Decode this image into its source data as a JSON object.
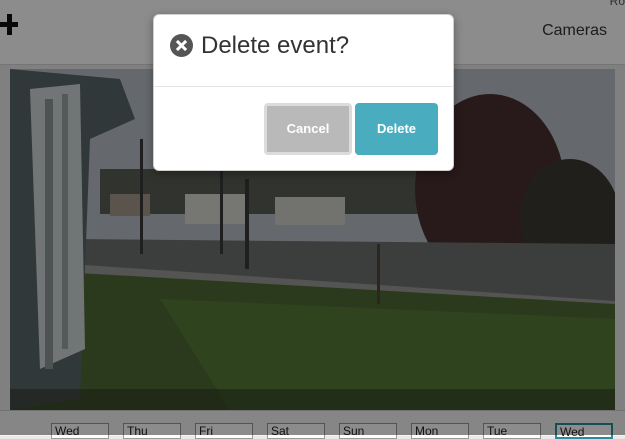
{
  "header": {
    "add_icon": "plus-icon",
    "nav_cameras": "Cameras",
    "corner_text": "Ro"
  },
  "timeline": {
    "days": [
      {
        "label": "Wed",
        "active": false
      },
      {
        "label": "Thu",
        "active": false
      },
      {
        "label": "Fri",
        "active": false
      },
      {
        "label": "Sat",
        "active": false
      },
      {
        "label": "Sun",
        "active": false
      },
      {
        "label": "Mon",
        "active": false
      },
      {
        "label": "Tue",
        "active": false
      },
      {
        "label": "Wed",
        "active": true
      }
    ]
  },
  "dialog": {
    "title": "Delete event?",
    "close_icon": "close-circle-icon",
    "cancel_label": "Cancel",
    "delete_label": "Delete"
  },
  "colors": {
    "delete_button": "#4aacbf",
    "cancel_button": "#b9b9b9",
    "active_day_border": "#2a8c9c"
  }
}
